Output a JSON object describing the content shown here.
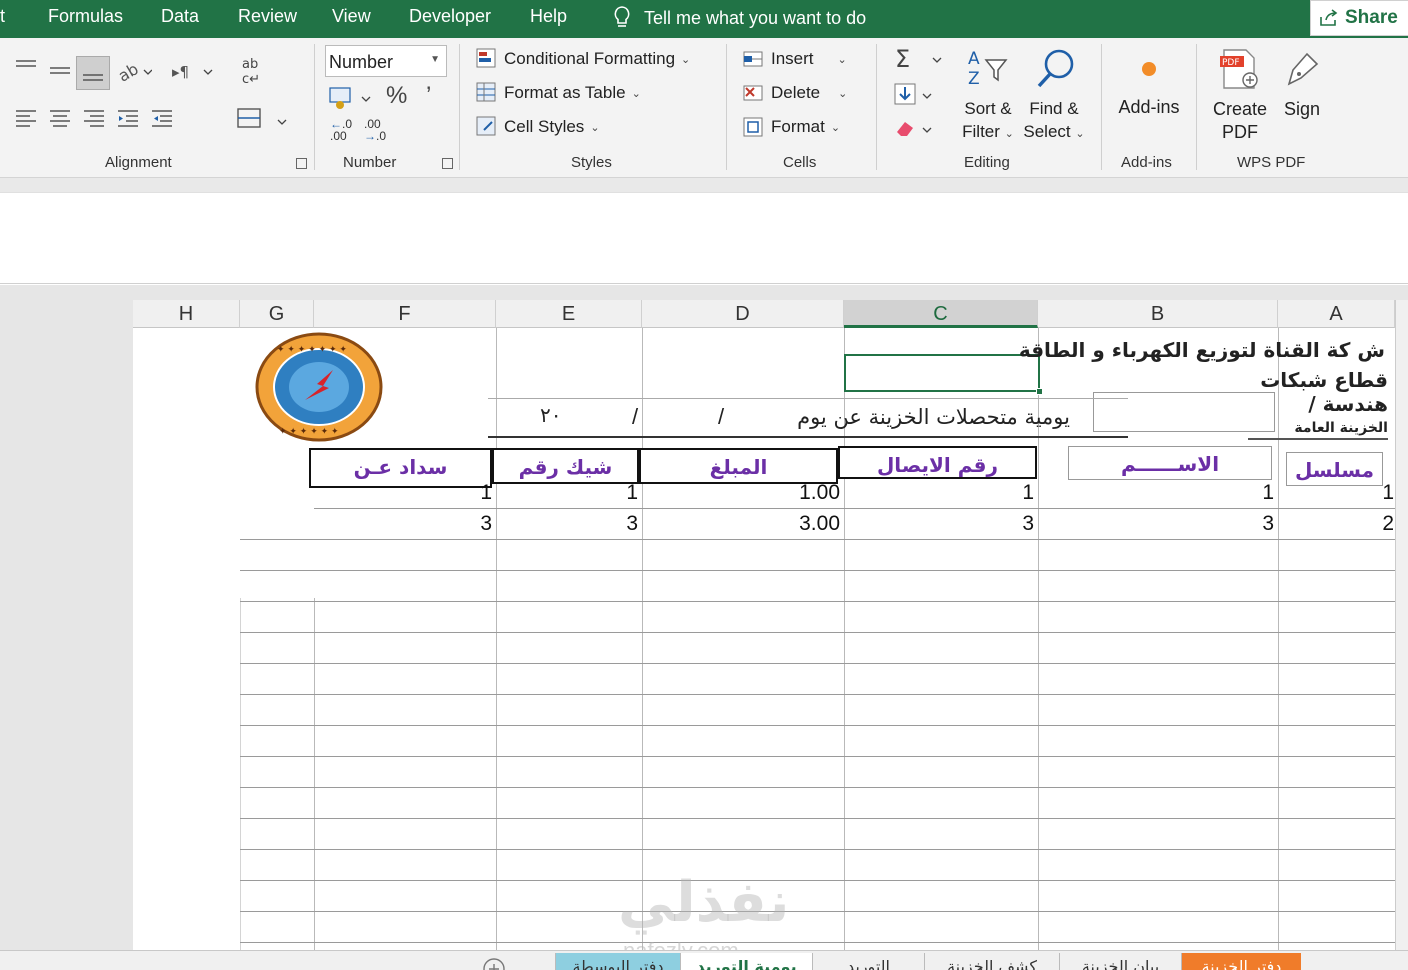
{
  "menubar": {
    "items": [
      "t",
      "Formulas",
      "Data",
      "Review",
      "View",
      "Developer",
      "Help"
    ],
    "tell_me": "Tell me what you want to do",
    "share": "Share"
  },
  "ribbon": {
    "alignment": {
      "label": "Alignment"
    },
    "number": {
      "format_value": "Number",
      "label": "Number",
      "percent": "%",
      "comma": "’",
      "inc_decimal": ".00",
      "dec_decimal": ".0"
    },
    "styles": {
      "conditional": "Conditional Formatting",
      "table": "Format as Table",
      "cell_styles": "Cell Styles",
      "label": "Styles"
    },
    "cells": {
      "insert": "Insert",
      "delete": "Delete",
      "format": "Format",
      "label": "Cells"
    },
    "editing": {
      "sort_l1": "Sort &",
      "sort_l2": "Filter",
      "find_l1": "Find &",
      "find_l2": "Select",
      "label": "Editing"
    },
    "addins": {
      "button": "Add-ins",
      "label": "Add-ins"
    },
    "wps": {
      "create_l1": "Create",
      "create_l2": "PDF",
      "sign": "Sign",
      "label": "WPS PDF"
    }
  },
  "sheet": {
    "columns": [
      "H",
      "G",
      "F",
      "E",
      "D",
      "C",
      "B",
      "A"
    ],
    "selected_column": "C",
    "company_line1": "ش كة القناة لتوزيع الكهرباء و الطاقة",
    "company_line2": "قطاع شبكات",
    "company_line3": "هندسة /",
    "company_line4": "الخزينة العامة",
    "report_title": "يومية متحصلات الخزينة عن يوم",
    "date_slash1": "/",
    "date_slash2": "/",
    "date_year": "٢٠",
    "headers": {
      "serial": "مسلسل",
      "name": "الاســــــم",
      "receipt": "رقم الايصال",
      "amount": "المبلغ",
      "check": "شيك رقم",
      "payment_for": "سداد عـن"
    },
    "rows": [
      {
        "serial": "1",
        "name": "1",
        "receipt": "1",
        "amount": "1.00",
        "check": "1",
        "payment_for": "1"
      },
      {
        "serial": "2",
        "name": "3",
        "receipt": "3",
        "amount": "3.00",
        "check": "3",
        "payment_for": "3"
      }
    ]
  },
  "tabs": [
    "دفتر الخزينة",
    "بيان الخزينة",
    "كشف الخزينة",
    "التوريد",
    "يومية التوريد",
    "دفتر البوسطة"
  ],
  "watermark": {
    "brand": "نفذلي",
    "url": "nafezly.com"
  },
  "colors": {
    "excel_green": "#217346",
    "header_purple": "#6b2fa6",
    "active_tab": "#f07c2a",
    "selected_tab": "#8ecfe0"
  }
}
